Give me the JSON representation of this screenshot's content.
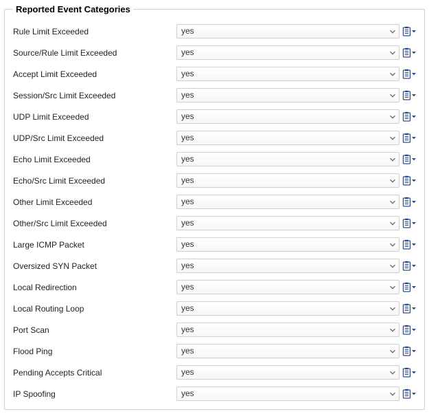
{
  "fieldset": {
    "legend": "Reported Event Categories"
  },
  "rows": [
    {
      "label": "Rule Limit Exceeded",
      "value": "yes"
    },
    {
      "label": "Source/Rule Limit Exceeded",
      "value": "yes"
    },
    {
      "label": "Accept Limit Exceeded",
      "value": "yes"
    },
    {
      "label": "Session/Src Limit Exceeded",
      "value": "yes"
    },
    {
      "label": "UDP Limit Exceeded",
      "value": "yes"
    },
    {
      "label": "UDP/Src Limit Exceeded",
      "value": "yes"
    },
    {
      "label": "Echo Limit Exceeded",
      "value": "yes"
    },
    {
      "label": "Echo/Src Limit Exceeded",
      "value": "yes"
    },
    {
      "label": "Other Limit Exceeded",
      "value": "yes"
    },
    {
      "label": "Other/Src Limit Exceeded",
      "value": "yes"
    },
    {
      "label": "Large ICMP Packet",
      "value": "yes"
    },
    {
      "label": "Oversized SYN Packet",
      "value": "yes"
    },
    {
      "label": "Local Redirection",
      "value": "yes"
    },
    {
      "label": "Local Routing Loop",
      "value": "yes"
    },
    {
      "label": "Port Scan",
      "value": "yes"
    },
    {
      "label": "Flood Ping",
      "value": "yes"
    },
    {
      "label": "Pending Accepts Critical",
      "value": "yes"
    },
    {
      "label": "IP Spoofing",
      "value": "yes"
    }
  ]
}
